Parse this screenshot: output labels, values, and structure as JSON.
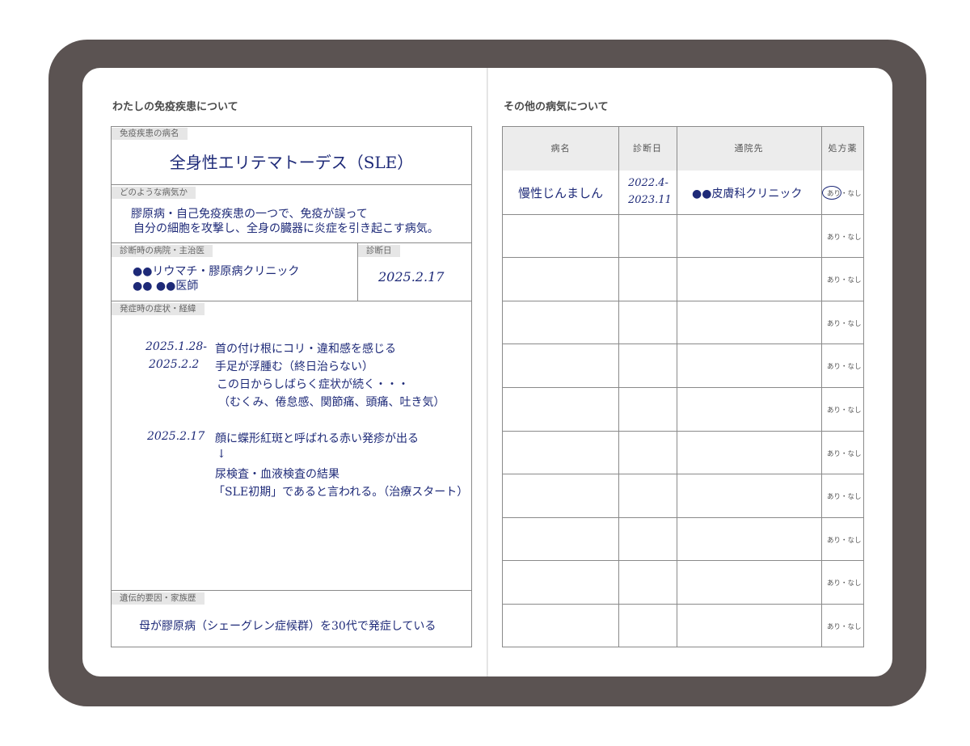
{
  "left": {
    "title": "わたしの免疫疾患について",
    "disease_label": "免疫疾患の病名",
    "disease_value": "全身性エリテマトーデス（SLE）",
    "what_label": "どのような病気か",
    "what_lines": [
      "膠原病・自己免疫疾患の一つで、免疫が誤って",
      "自分の細胞を攻撃し、全身の臓器に炎症を引き起こす病気。"
    ],
    "hospital_label": "診断時の病院・主治医",
    "hospital_lines": [
      "●●リウマチ・膠原病クリニック",
      "●● ●●医師"
    ],
    "diag_date_label": "診断日",
    "diag_date_value": "2025.2.17",
    "symptom_label": "発症時の症状・経緯",
    "symptoms": [
      {
        "date": "2025.1.28-",
        "text": "首の付け根にコリ・違和感を感じる"
      },
      {
        "date": "2025.2.2",
        "text": "手足が浮腫む（終日治らない）"
      },
      {
        "date": "",
        "text": "この日からしばらく症状が続く・・・"
      },
      {
        "date": "",
        "text": "（むくみ、倦怠感、関節痛、頭痛、吐き気）"
      },
      {
        "date": "2025.2.17",
        "text": "顔に蝶形紅斑と呼ばれる赤い発疹が出る"
      },
      {
        "date": "",
        "text": "↓"
      },
      {
        "date": "",
        "text": "尿検査・血液検査の結果"
      },
      {
        "date": "",
        "text": "「SLE初期」であると言われる。（治療スタート）"
      }
    ],
    "family_label": "遺伝的要因・家族歴",
    "family_value": "母が膠原病（シェーグレン症候群）を30代で発症している"
  },
  "right": {
    "title": "その他の病気について",
    "headers": [
      "病名",
      "診断日",
      "通院先",
      "処方薬"
    ],
    "rows": [
      {
        "name": "慢性じんましん",
        "date1": "2022.4-",
        "date2": "2023.11",
        "clinic": "●●皮膚科クリニック",
        "rx": "あり・なし",
        "circled": "あり"
      },
      {
        "name": "",
        "date1": "",
        "date2": "",
        "clinic": "",
        "rx": "あり・なし"
      },
      {
        "name": "",
        "date1": "",
        "date2": "",
        "clinic": "",
        "rx": "あり・なし"
      },
      {
        "name": "",
        "date1": "",
        "date2": "",
        "clinic": "",
        "rx": "あり・なし"
      },
      {
        "name": "",
        "date1": "",
        "date2": "",
        "clinic": "",
        "rx": "あり・なし"
      },
      {
        "name": "",
        "date1": "",
        "date2": "",
        "clinic": "",
        "rx": "あり・なし"
      },
      {
        "name": "",
        "date1": "",
        "date2": "",
        "clinic": "",
        "rx": "あり・なし"
      },
      {
        "name": "",
        "date1": "",
        "date2": "",
        "clinic": "",
        "rx": "あり・なし"
      },
      {
        "name": "",
        "date1": "",
        "date2": "",
        "clinic": "",
        "rx": "あり・なし"
      },
      {
        "name": "",
        "date1": "",
        "date2": "",
        "clinic": "",
        "rx": "あり・なし"
      },
      {
        "name": "",
        "date1": "",
        "date2": "",
        "clinic": "",
        "rx": "あり・なし"
      }
    ]
  },
  "colors": {
    "cover": "#5b5352",
    "ink": "#1e2a78",
    "label_bg": "#e6e6e6",
    "header_bg": "#ececec"
  }
}
